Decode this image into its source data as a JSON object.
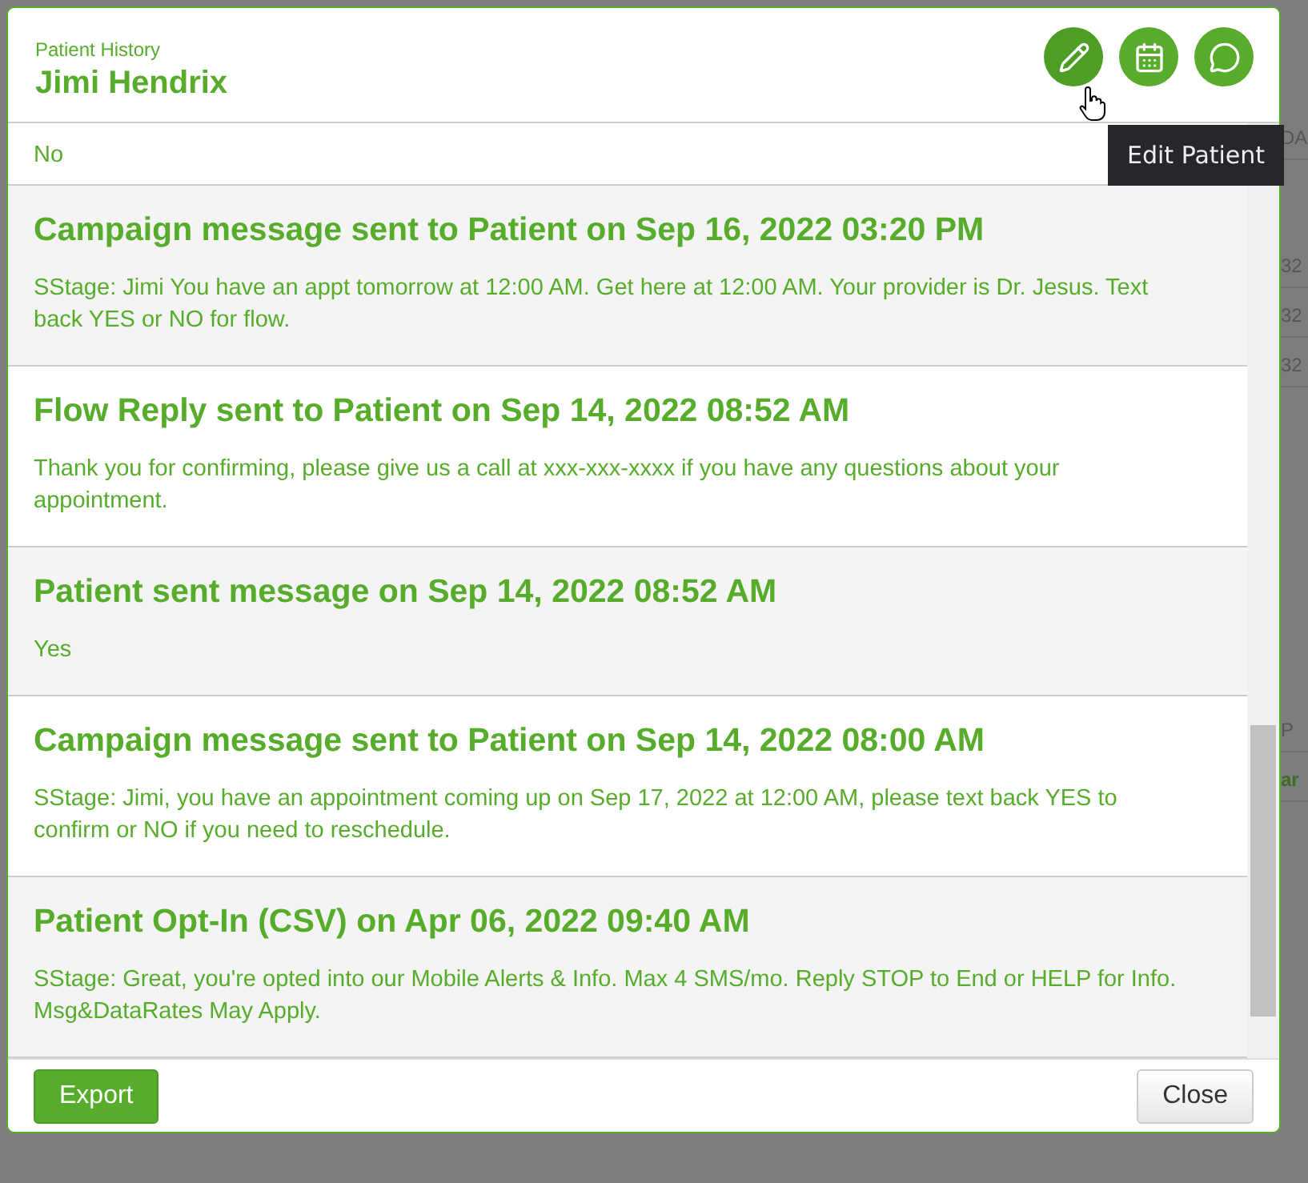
{
  "background_fragments": [
    {
      "text": "DA",
      "kind": "plain"
    },
    {
      "text": "32",
      "kind": "plain"
    },
    {
      "text": "32",
      "kind": "plain"
    },
    {
      "text": "32",
      "kind": "plain"
    },
    {
      "text": "P",
      "kind": "plain"
    },
    {
      "text": "ar",
      "kind": "link"
    }
  ],
  "dialog": {
    "subtitle": "Patient History",
    "title": "Jimi Hendrix",
    "actions": [
      {
        "kind": "edit",
        "hovered": true
      },
      {
        "kind": "calendar",
        "hovered": false
      },
      {
        "kind": "message",
        "hovered": false
      }
    ],
    "tooltip": "Edit Patient",
    "partial_entry": "No",
    "entries": [
      {
        "heading": "Campaign message sent to Patient on Sep 16, 2022 03:20 PM",
        "body": "SStage: Jimi You have an appt tomorrow at 12:00 AM. Get here at 12:00 AM. Your provider is Dr. Jesus. Text back YES or NO for flow."
      },
      {
        "heading": "Flow Reply sent to Patient on Sep 14, 2022 08:52 AM",
        "body": "Thank you for confirming, please give us a call at xxx-xxx-xxxx if you have any questions about your appointment."
      },
      {
        "heading": "Patient sent message on Sep 14, 2022 08:52 AM",
        "body": "Yes"
      },
      {
        "heading": "Campaign message sent to Patient on Sep 14, 2022 08:00 AM",
        "body": "SStage: Jimi, you have an appointment coming up on Sep 17, 2022 at 12:00 AM, please text back YES to confirm or NO if you need to reschedule."
      },
      {
        "heading": "Patient Opt-In (CSV) on Apr 06, 2022 09:40 AM",
        "body": "SStage: Great, you're opted into our Mobile Alerts & Info. Max 4 SMS/mo. Reply STOP to End or HELP for Info. Msg&DataRates May Apply."
      }
    ],
    "buttons": [
      {
        "label": "Export",
        "kind": "primary"
      },
      {
        "label": "Close",
        "kind": "default"
      }
    ]
  }
}
